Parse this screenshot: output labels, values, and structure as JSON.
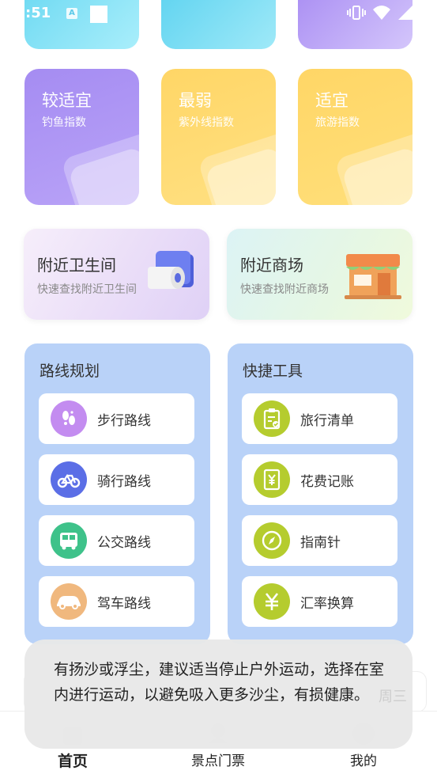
{
  "status_bar": {
    "time": ":51",
    "a_badge": "A"
  },
  "index_cards": [
    {
      "value": "较适宜",
      "label": "钓鱼指数",
      "color": "#a58cf2"
    },
    {
      "value": "最弱",
      "label": "紫外线指数",
      "color": "#ffd666"
    },
    {
      "value": "适宜",
      "label": "旅游指数",
      "color": "#ffd666"
    }
  ],
  "nearby": {
    "toilet": {
      "title": "附近卫生间",
      "subtitle": "快速查找附近卫生间",
      "icon": "toilet-paper-icon"
    },
    "mall": {
      "title": "附近商场",
      "subtitle": "快速查找附近商场",
      "icon": "shop-icon"
    }
  },
  "route_panel": {
    "title": "路线规划",
    "items": [
      {
        "label": "步行路线",
        "icon": "footprints-icon",
        "color": "#c38cf0"
      },
      {
        "label": "骑行路线",
        "icon": "bicycle-icon",
        "color": "#5b6ee6"
      },
      {
        "label": "公交路线",
        "icon": "bus-icon",
        "color": "#3ec28a"
      },
      {
        "label": "驾车路线",
        "icon": "car-icon",
        "color": "#f0b87e"
      }
    ]
  },
  "tools_panel": {
    "title": "快捷工具",
    "items": [
      {
        "label": "旅行清单",
        "icon": "clipboard-check-icon",
        "color": "#b5cc2e"
      },
      {
        "label": "花费记账",
        "icon": "yuan-notebook-icon",
        "color": "#b5cc2e"
      },
      {
        "label": "指南针",
        "icon": "compass-icon",
        "color": "#b5cc2e"
      },
      {
        "label": "汇率换算",
        "icon": "yuan-icon",
        "color": "#b5cc2e"
      }
    ]
  },
  "toast": {
    "message": "有扬沙或浮尘，建议适当停止户外运动，选择在室内进行运动，以避免吸入更多沙尘，有损健康。"
  },
  "peek": {
    "text": "周三"
  },
  "bottom_nav": [
    {
      "label": "首页",
      "active": true
    },
    {
      "label": "景点门票",
      "active": false
    },
    {
      "label": "我的",
      "active": false
    }
  ]
}
